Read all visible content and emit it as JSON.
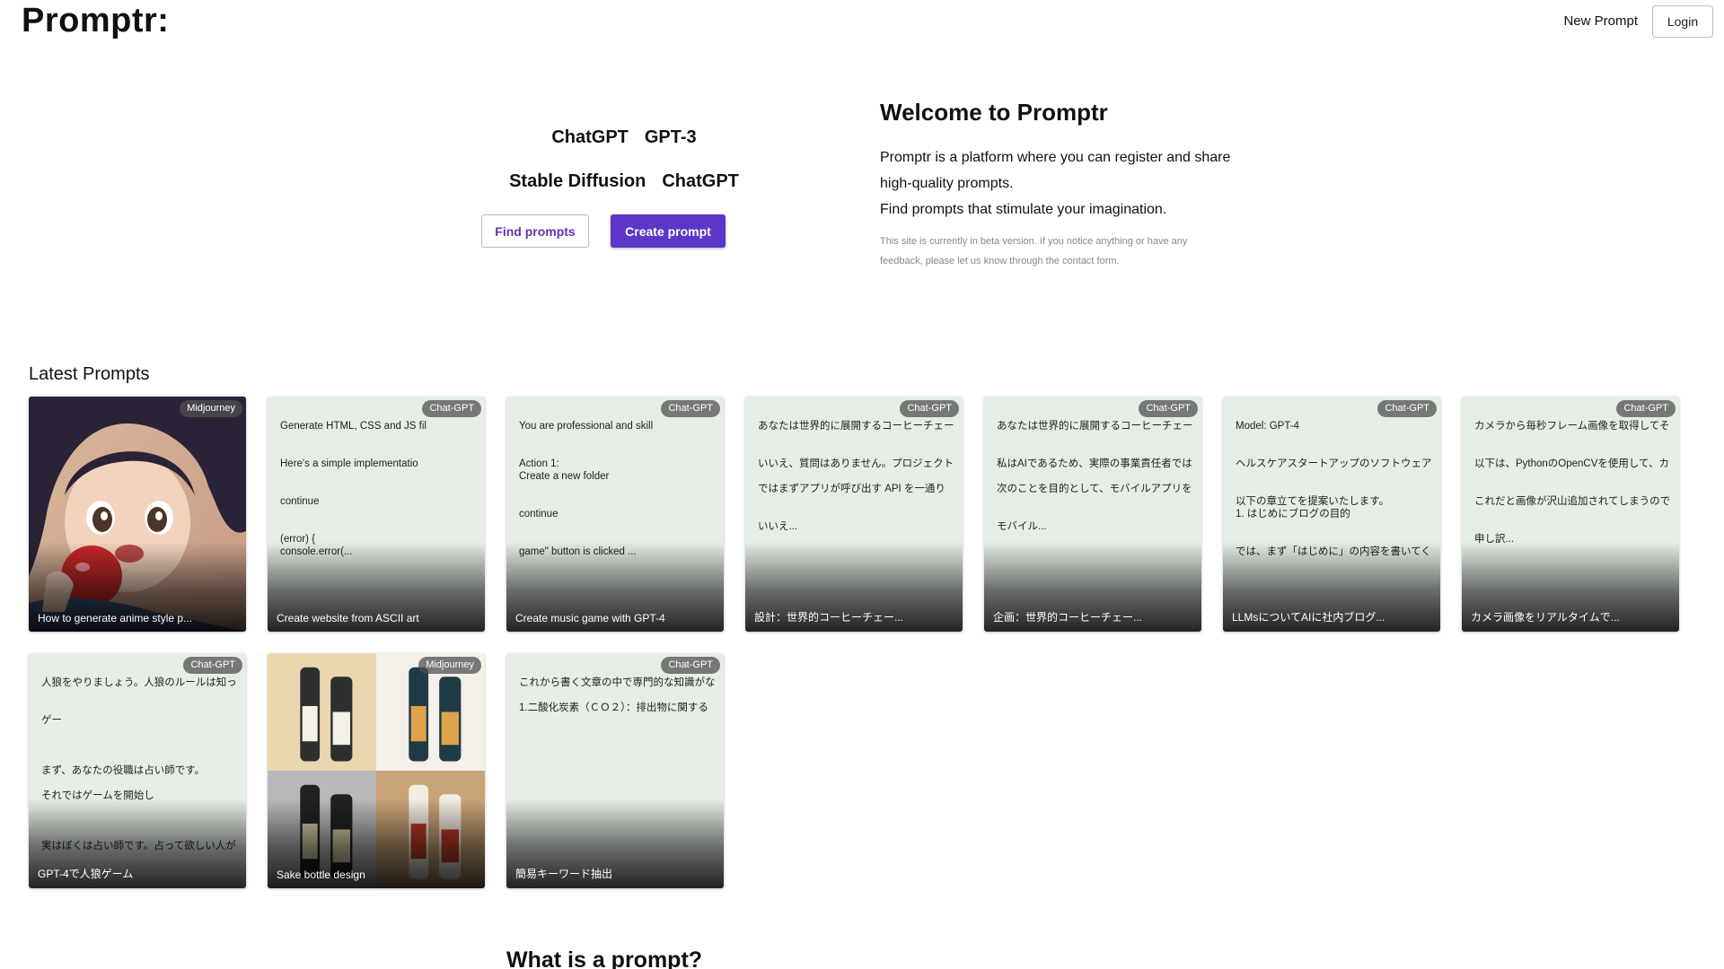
{
  "header": {
    "logo": "Promptr:",
    "new_prompt": "New Prompt",
    "login": "Login"
  },
  "hero": {
    "row1": [
      "ChatGPT",
      "GPT-3"
    ],
    "row2": [
      "Stable Diffusion",
      "ChatGPT"
    ],
    "find_button": "Find prompts",
    "create_button": "Create prompt",
    "title": "Welcome to Promptr",
    "desc_lines": [
      "Promptr is a platform where you can register and share",
      "high-quality prompts.",
      "Find prompts that stimulate your imagination."
    ],
    "note_lines": [
      "This site is currently in beta version. If you notice anything or have any",
      "feedback, please let us know through the contact form."
    ]
  },
  "latest": {
    "title": "Latest Prompts",
    "cards": [
      {
        "type": "image-anime",
        "badge": "Midjourney",
        "title": "How to generate anime style p...",
        "lines": []
      },
      {
        "type": "text",
        "badge": "Chat-GPT",
        "title": "Create website from ASCII art",
        "lines": [
          "Generate HTML, CSS and JS fil",
          "",
          "",
          "Here's a simple implementatio",
          "",
          "",
          "continue",
          "",
          "",
          "(error) {",
          "console.error(..."
        ]
      },
      {
        "type": "text",
        "badge": "Chat-GPT",
        "title": "Create music game with GPT-4",
        "lines": [
          "You are professional and skill",
          "",
          "",
          "Action 1:",
          "Create a new folder",
          "",
          "",
          "continue",
          "",
          "",
          "game\" button is clicked ..."
        ]
      },
      {
        "type": "text",
        "badge": "Chat-GPT",
        "title": "設計：世界的コーヒーチェー...",
        "lines": [
          "あなたは世界的に展開するコーヒーチェー",
          "",
          "",
          "いいえ、質問はありません。プロジェクト",
          "",
          "ではまずアプリが呼び出す API を一通り",
          "",
          "",
          "いいえ..."
        ]
      },
      {
        "type": "text",
        "badge": "Chat-GPT",
        "title": "企画：世界的コーヒーチェー...",
        "lines": [
          "あなたは世界的に展開するコーヒーチェー",
          "",
          "",
          "私はAIであるため、実際の事業責任者では",
          "",
          "次のことを目的として、モバイルアプリを",
          "",
          "",
          "モバイル..."
        ]
      },
      {
        "type": "text",
        "badge": "Chat-GPT",
        "title": "LLMsについてAIに社内ブログ...",
        "lines": [
          "Model: GPT-4",
          "",
          "",
          "ヘルスケアスタートアップのソフトウェア",
          "",
          "",
          "以下の章立てを提案いたします。",
          "1. はじめにブログの目的",
          "",
          "",
          "では、まず「はじめに」の内容を書いてく"
        ]
      },
      {
        "type": "text",
        "badge": "Chat-GPT",
        "title": "カメラ画像をリアルタイムで...",
        "lines": [
          "カメラから毎秒フレーム画像を取得してそ",
          "",
          "",
          "以下は、PythonのOpenCVを使用して、カ",
          "",
          "",
          "これだと画像が沢山追加されてしまうので",
          "",
          "",
          "申し訳..."
        ]
      },
      {
        "type": "text",
        "badge": "Chat-GPT",
        "title": "GPT-4で人狼ゲーム",
        "lines": [
          "人狼をやりましょう。人狼のルールは知っ",
          "",
          "",
          "ゲー",
          "",
          "",
          "",
          "まず、あなたの役職は占い師です。",
          "",
          "それではゲームを開始し",
          "",
          "",
          "",
          "実はぼくは占い師です。占って欲しい人が"
        ]
      },
      {
        "type": "image-sake",
        "badge": "Midjourney",
        "title": "Sake bottle design",
        "lines": []
      },
      {
        "type": "text",
        "badge": "Chat-GPT",
        "title": "簡易キーワード抽出",
        "lines": [
          "これから書く文章の中で専門的な知識がな",
          "",
          "1.二酸化炭素（ＣＯ２）：排出物に関する"
        ]
      }
    ]
  },
  "bottom": {
    "title": "What is a prompt?"
  }
}
